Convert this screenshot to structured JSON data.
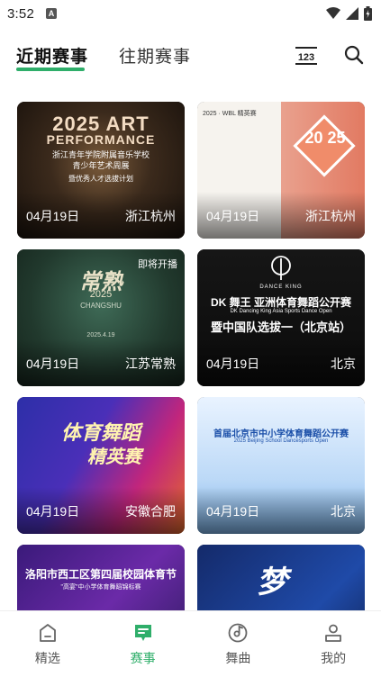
{
  "status_bar": {
    "time": "3:52",
    "notification_letter": "A"
  },
  "header": {
    "tabs": [
      {
        "label": "近期赛事",
        "active": true
      },
      {
        "label": "往期赛事",
        "active": false
      }
    ],
    "calendar_icon_text": "123"
  },
  "accent_color": "#2fae6a",
  "events": [
    {
      "date": "04月19日",
      "city": "浙江杭州",
      "poster_title": "2025 ART",
      "poster_subtitle": "PERFORMANCE",
      "poster_line1": "浙江青年学院附属音乐学校",
      "poster_line2": "青少年艺术周展",
      "poster_line3": "暨优秀人才选拔计划"
    },
    {
      "date": "04月19日",
      "city": "浙江杭州",
      "poster_title": "2025 · WBL 精英赛",
      "poster_subtitle": "20 25"
    },
    {
      "date": "04月19日",
      "city": "江苏常熟",
      "badge": "即将开播",
      "poster_title": "常熟",
      "poster_subtitle": "2025",
      "poster_line1": "CHANGSHU",
      "poster_line2": "2025.4.19"
    },
    {
      "date": "04月19日",
      "city": "北京",
      "poster_title": "DANCE KING",
      "poster_subtitle": "DK 舞王 亚洲体育舞蹈公开赛",
      "poster_line1": "DK Dancing King Asia Sports Dance Open",
      "poster_line2": "暨中国队选拔一（北京站）"
    },
    {
      "date": "04月19日",
      "city": "安徽合肥",
      "poster_title": "体育舞蹈",
      "poster_subtitle": "精英赛"
    },
    {
      "date": "04月19日",
      "city": "北京",
      "poster_title": "首届北京市中小学体育舞蹈公开赛",
      "poster_subtitle": "2025 Beijing School Dancesports Open"
    },
    {
      "poster_title": "洛阳市西工区第四届校园体育节",
      "poster_subtitle": "\"高宴\"中小学体育舞蹈锦标赛"
    },
    {
      "poster_title": "梦"
    }
  ],
  "bottom_nav": [
    {
      "label": "精选",
      "icon": "home-icon",
      "active": false
    },
    {
      "label": "赛事",
      "icon": "event-list-icon",
      "active": true
    },
    {
      "label": "舞曲",
      "icon": "music-disc-icon",
      "active": false
    },
    {
      "label": "我的",
      "icon": "profile-icon",
      "active": false
    }
  ]
}
